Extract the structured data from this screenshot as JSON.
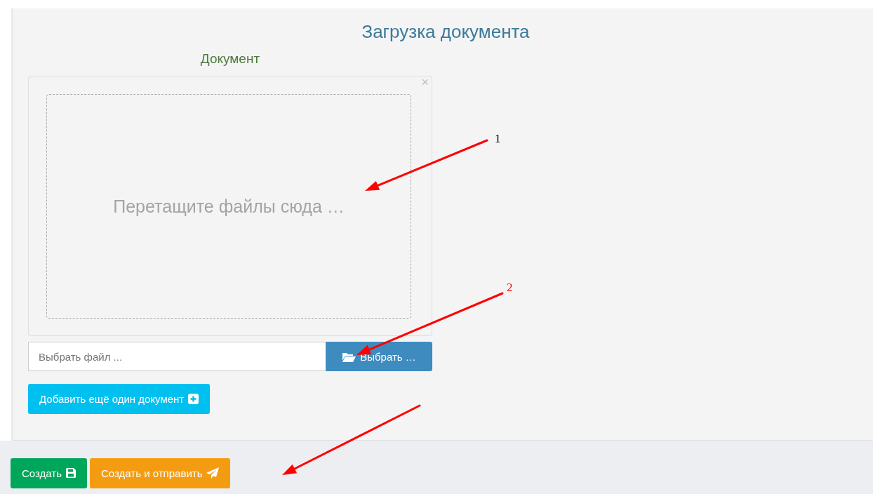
{
  "panel": {
    "title": "Загрузка документа",
    "document_label": "Документ",
    "dropzone": {
      "hint": "Перетащите файлы сюда …",
      "close": "×"
    },
    "file_field": {
      "placeholder": "Выбрать файл ..."
    },
    "browse_button": "Выбрать …",
    "add_button": "Добавить ещё один документ"
  },
  "actions": [
    {
      "label": "Создать",
      "kind": "save",
      "color": "#00a65a"
    },
    {
      "label": "Создать и отправить",
      "kind": "send",
      "color": "#f39c12"
    }
  ],
  "annotations": [
    {
      "label": "1",
      "color": "#000000"
    },
    {
      "label": "2",
      "color": "#ff0000"
    }
  ]
}
